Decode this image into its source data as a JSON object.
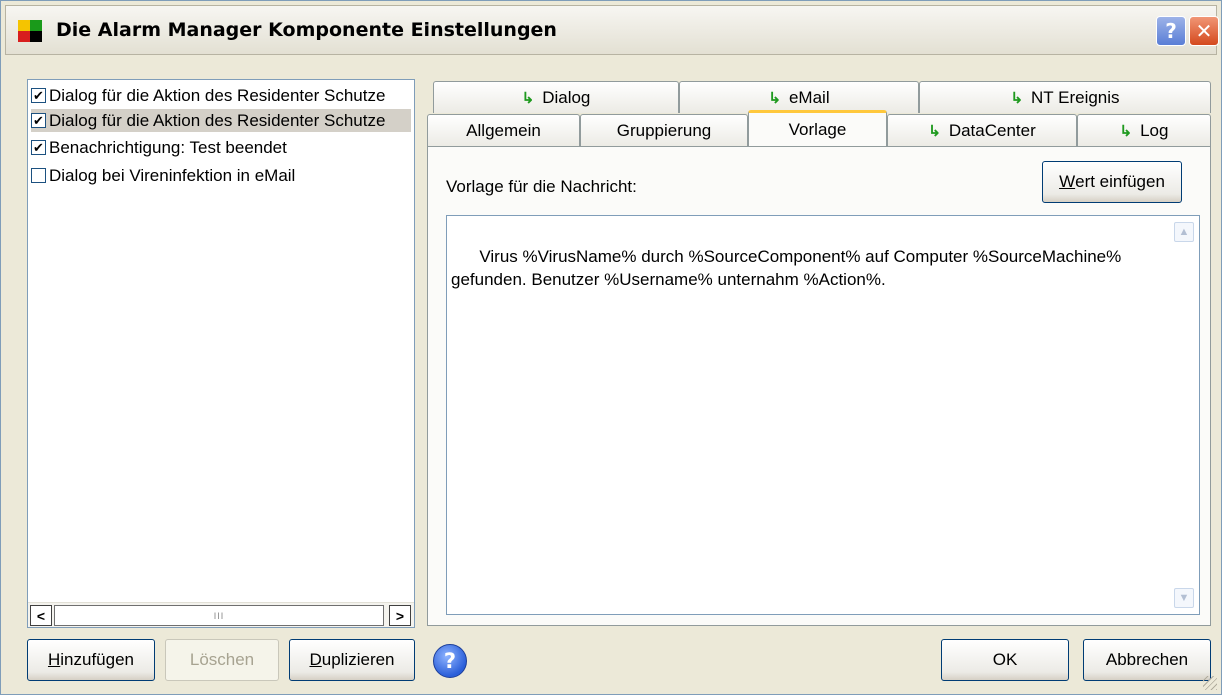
{
  "window": {
    "title": "Die Alarm Manager Komponente Einstellungen",
    "help_glyph": "?",
    "close_glyph": "✕"
  },
  "list": {
    "items": [
      {
        "label": "Dialog für die Aktion des Residenter Schutze",
        "checked": true,
        "selected": false
      },
      {
        "label": "Dialog für die Aktion des Residenter Schutze",
        "checked": true,
        "selected": true
      },
      {
        "label": "Benachrichtigung: Test beendet",
        "checked": true,
        "selected": false
      },
      {
        "label": "Dialog bei Vireninfektion in eMail",
        "checked": false,
        "selected": false
      }
    ],
    "check_glyph": "✔",
    "scroll_left": "<",
    "scroll_right": ">",
    "thumb_grip": "III"
  },
  "left_buttons": {
    "add": {
      "first": "H",
      "rest": "inzufügen"
    },
    "delete": "Löschen",
    "duplicate": {
      "first": "D",
      "rest": "uplizieren"
    }
  },
  "tabs": {
    "row1": [
      {
        "label": "Dialog",
        "icon": "arrow-icon"
      },
      {
        "label": "eMail",
        "icon": "arrow-icon"
      },
      {
        "label": "NT Ereignis",
        "icon": "arrow-icon"
      }
    ],
    "row2": [
      {
        "label": "Allgemein"
      },
      {
        "label": "Gruppierung"
      },
      {
        "label": "Vorlage",
        "active": true
      },
      {
        "label": "DataCenter",
        "icon": "arrow-icon"
      },
      {
        "label": "Log",
        "icon": "arrow-icon"
      }
    ],
    "icon_glyph": "↳"
  },
  "panel": {
    "label": "Vorlage für die Nachricht:",
    "insert_button": {
      "first": "W",
      "rest": "ert einfügen"
    },
    "template_text": "Virus %VirusName% durch %SourceComponent% auf Computer %SourceMachine%\ngefunden. Benutzer %Username% unternahm %Action%.",
    "scroll_up": "▲",
    "scroll_down": "▼"
  },
  "footer": {
    "help_glyph": "?",
    "ok": "OK",
    "cancel": "Abbrechen"
  }
}
